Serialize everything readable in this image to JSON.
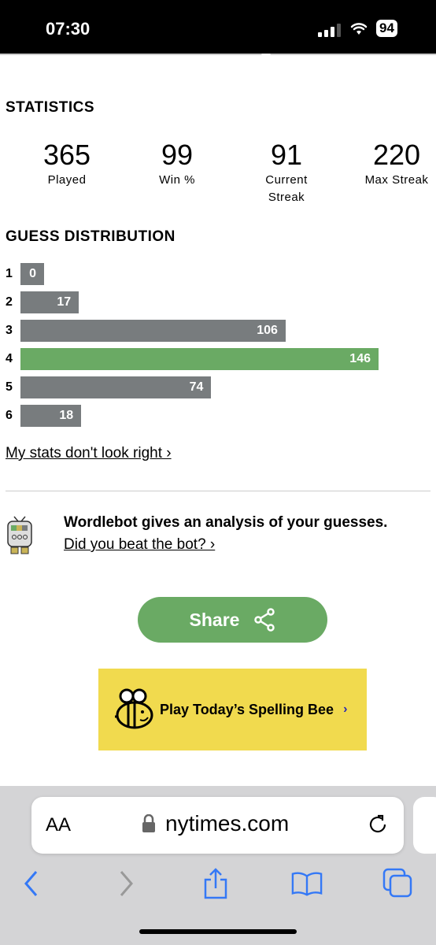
{
  "status_bar": {
    "time": "07:30",
    "battery": "94"
  },
  "statistics": {
    "title": "STATISTICS",
    "items": [
      {
        "value": "365",
        "label": "Played"
      },
      {
        "value": "99",
        "label": "Win %"
      },
      {
        "value": "91",
        "label": "Current Streak"
      },
      {
        "value": "220",
        "label": "Max Streak"
      }
    ]
  },
  "guess_distribution": {
    "title": "GUESS DISTRIBUTION",
    "current_guess": "4",
    "rows": [
      {
        "guess": "1",
        "count": 0
      },
      {
        "guess": "2",
        "count": 17
      },
      {
        "guess": "3",
        "count": 106
      },
      {
        "guess": "4",
        "count": 146
      },
      {
        "guess": "5",
        "count": 74
      },
      {
        "guess": "6",
        "count": 18
      }
    ],
    "bar_color": "#787c7e",
    "highlight_color": "#6aaa64"
  },
  "stats_link": "My stats don't look right ›",
  "wordlebot": {
    "title": "Wordlebot gives an analysis of your guesses.",
    "link": "Did you beat the bot? ›"
  },
  "share": {
    "label": "Share"
  },
  "spelling_bee": {
    "label": "Play Today’s Spelling Bee",
    "chevron": "›"
  },
  "browser": {
    "aa": "AA",
    "url": "nytimes.com",
    "accent": "#3478f6"
  }
}
